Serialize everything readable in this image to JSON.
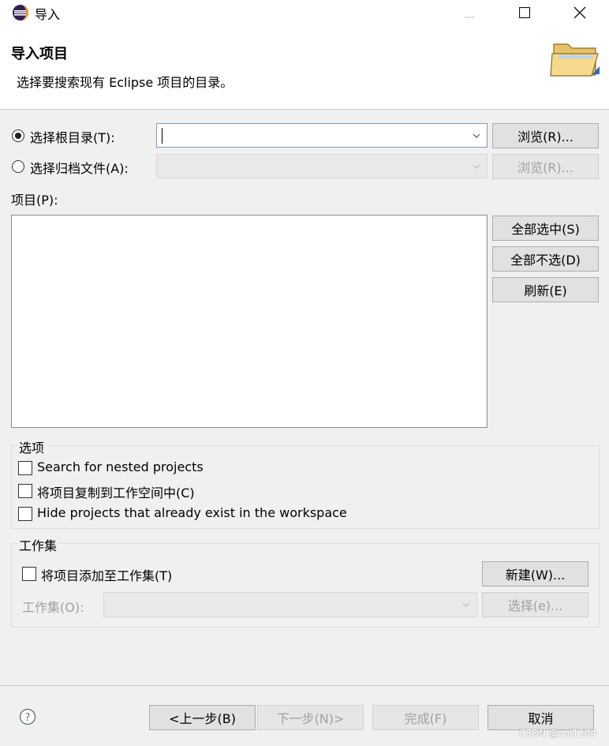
{
  "window": {
    "title": "导入"
  },
  "header": {
    "title": "导入项目",
    "description": "选择要搜索现有 Eclipse 项目的目录。"
  },
  "source": {
    "root_dir_label": "选择根目录(T):",
    "root_dir_value": "",
    "archive_label": "选择归档文件(A):",
    "archive_value": "",
    "browse_root": "浏览(R)...",
    "browse_archive": "浏览(R)...",
    "selected": "root_dir"
  },
  "projects": {
    "label": "项目(P):",
    "items": [],
    "select_all": "全部选中(S)",
    "deselect_all": "全部不选(D)",
    "refresh": "刷新(E)"
  },
  "options": {
    "title": "选项",
    "nested": {
      "label": "Search for nested projects",
      "checked": false
    },
    "copy": {
      "label": "将项目复制到工作空间中(C)",
      "checked": false
    },
    "hide": {
      "label": "Hide projects that already exist in the workspace",
      "checked": false
    }
  },
  "working_sets": {
    "title": "工作集",
    "add": {
      "label": "将项目添加至工作集(T)",
      "checked": false
    },
    "new_button": "新建(W)...",
    "sets_label": "工作集(O):",
    "sets_value": "",
    "select_button": "选择(e)..."
  },
  "footer": {
    "back": "<上一步(B)",
    "next": "下一步(N)>",
    "finish": "完成(F)",
    "cancel": "取消"
  },
  "watermark": "CSDN @cui1104",
  "colors": {
    "focus_border": "#7a9bb8",
    "button_bg": "#e1e1e1",
    "dialog_bg": "#f0f0f0"
  }
}
